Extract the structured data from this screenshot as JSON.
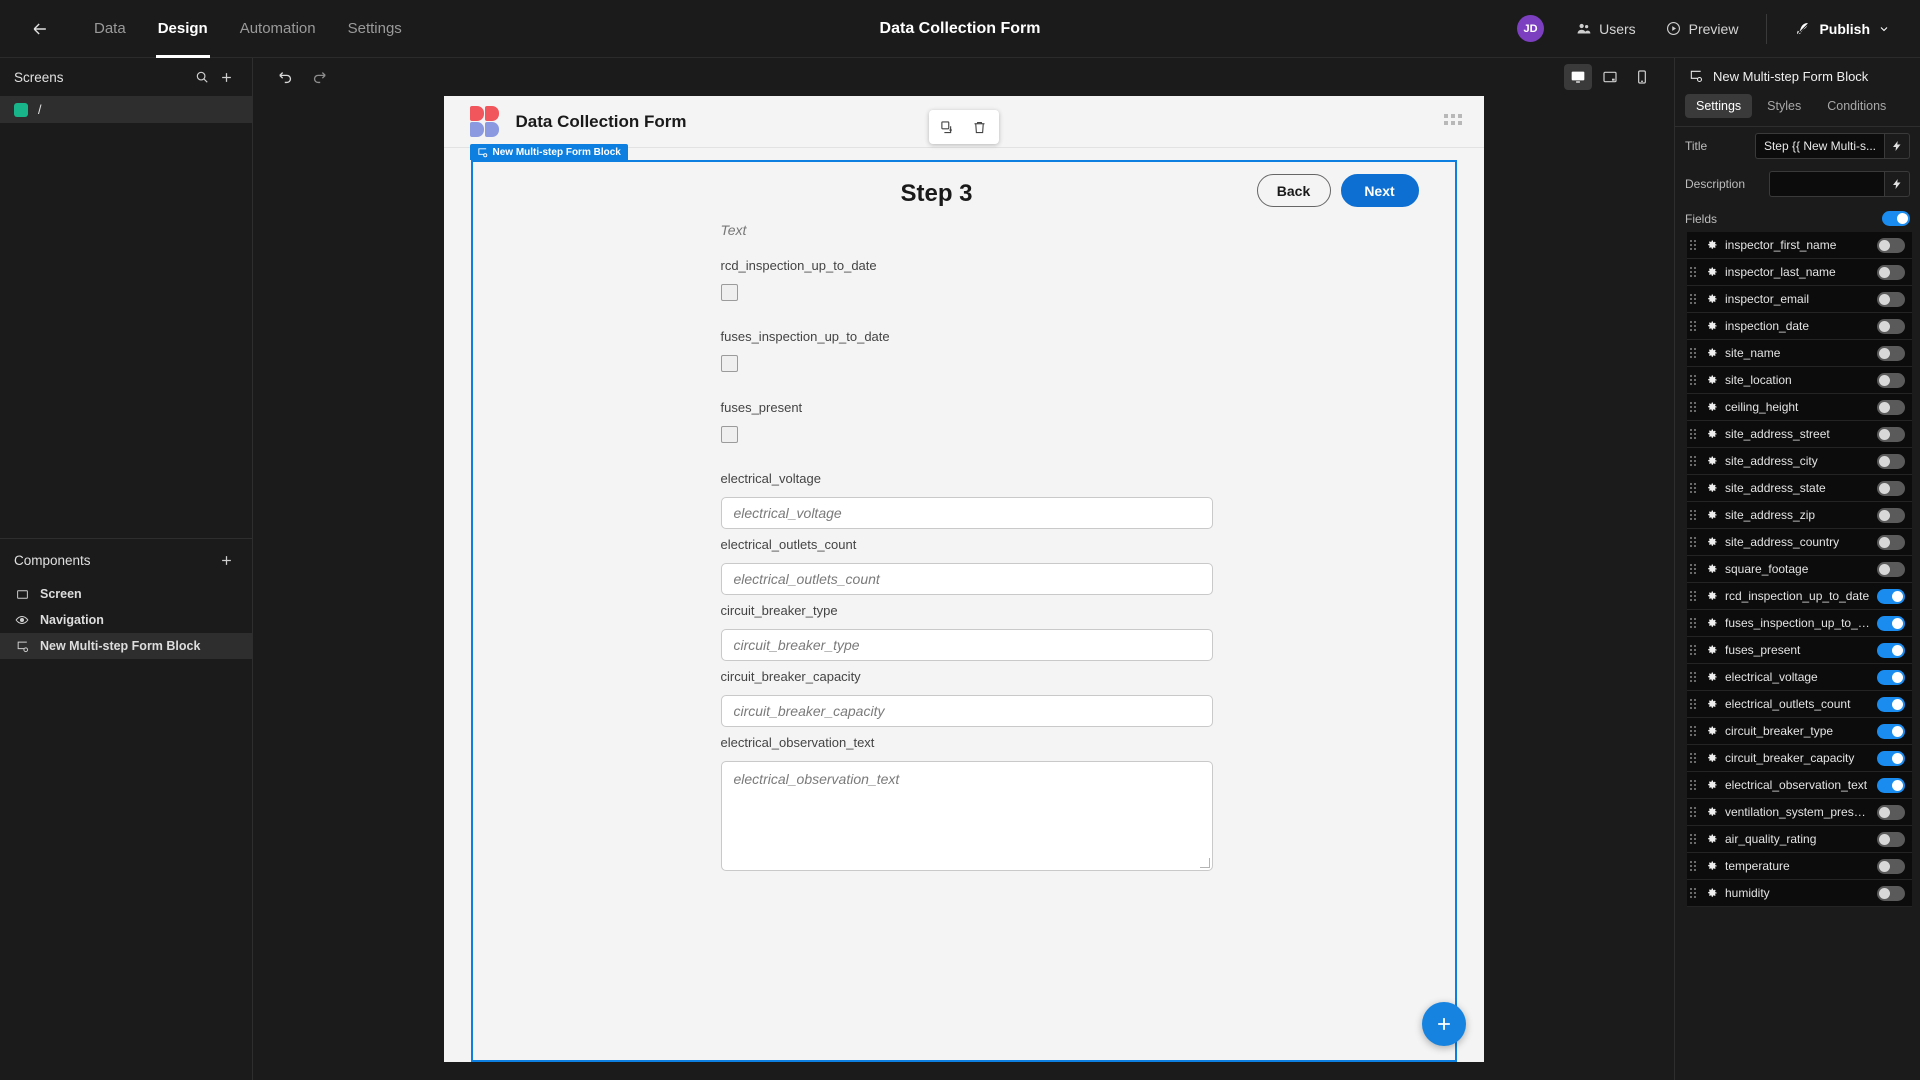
{
  "topbar": {
    "back_icon": "arrow-left-icon",
    "tabs": [
      {
        "label": "Data",
        "active": false
      },
      {
        "label": "Design",
        "active": true
      },
      {
        "label": "Automation",
        "active": false
      },
      {
        "label": "Settings",
        "active": false
      }
    ],
    "title": "Data Collection Form",
    "avatar_initials": "JD",
    "avatar_color": "#7b3fbf",
    "users_label": "Users",
    "preview_label": "Preview",
    "publish_label": "Publish"
  },
  "left_sidebar": {
    "screens_title": "Screens",
    "search_icon": "search-icon",
    "add_icon": "plus-icon",
    "screens": [
      {
        "label": "/",
        "color": "#18b58a",
        "selected": true
      }
    ],
    "components_title": "Components",
    "components_add_icon": "plus-icon",
    "components": [
      {
        "label": "Screen",
        "icon": "screen-icon",
        "selected": false
      },
      {
        "label": "Navigation",
        "icon": "eye-icon",
        "selected": false
      },
      {
        "label": "New Multi-step Form Block",
        "icon": "form-block-icon",
        "selected": true
      }
    ]
  },
  "canvas": {
    "undo_icon": "undo-icon",
    "redo_icon": "redo-icon",
    "devices": [
      {
        "name": "desktop-icon",
        "active": true
      },
      {
        "name": "tablet-icon",
        "active": false
      },
      {
        "name": "mobile-icon",
        "active": false
      }
    ],
    "form_name": "Data Collection Form",
    "header_actions": [
      {
        "name": "duplicate-icon"
      },
      {
        "name": "delete-icon"
      }
    ],
    "grid_icon": "grid-dots-icon",
    "block_badge": "New Multi-step Form Block",
    "step_title": "Step 3",
    "back_button": "Back",
    "next_button": "Next",
    "text_placeholder": "Text",
    "fields": [
      {
        "label": "rcd_inspection_up_to_date",
        "type": "checkbox"
      },
      {
        "label": "fuses_inspection_up_to_date",
        "type": "checkbox"
      },
      {
        "label": "fuses_present",
        "type": "checkbox"
      },
      {
        "label": "electrical_voltage",
        "type": "text",
        "placeholder": "electrical_voltage"
      },
      {
        "label": "electrical_outlets_count",
        "type": "text",
        "placeholder": "electrical_outlets_count"
      },
      {
        "label": "circuit_breaker_type",
        "type": "text",
        "placeholder": "circuit_breaker_type"
      },
      {
        "label": "circuit_breaker_capacity",
        "type": "text",
        "placeholder": "circuit_breaker_capacity"
      },
      {
        "label": "electrical_observation_text",
        "type": "textarea",
        "placeholder": "electrical_observation_text"
      }
    ],
    "fab_icon": "plus-icon",
    "accent_color": "#1683e0"
  },
  "right_panel": {
    "block_icon": "form-block-icon",
    "block_title": "New Multi-step Form Block",
    "tabs": [
      {
        "label": "Settings",
        "active": true
      },
      {
        "label": "Styles",
        "active": false
      },
      {
        "label": "Conditions",
        "active": false
      }
    ],
    "title_label": "Title",
    "title_value": "Step {{ New Multi-s...",
    "description_label": "Description",
    "description_value": "",
    "bolt_icon": "lightning-icon",
    "fields_label": "Fields",
    "fields_enabled": true,
    "fields": [
      {
        "name": "inspector_first_name",
        "enabled": false
      },
      {
        "name": "inspector_last_name",
        "enabled": false
      },
      {
        "name": "inspector_email",
        "enabled": false
      },
      {
        "name": "inspection_date",
        "enabled": false
      },
      {
        "name": "site_name",
        "enabled": false
      },
      {
        "name": "site_location",
        "enabled": false
      },
      {
        "name": "ceiling_height",
        "enabled": false
      },
      {
        "name": "site_address_street",
        "enabled": false
      },
      {
        "name": "site_address_city",
        "enabled": false
      },
      {
        "name": "site_address_state",
        "enabled": false
      },
      {
        "name": "site_address_zip",
        "enabled": false
      },
      {
        "name": "site_address_country",
        "enabled": false
      },
      {
        "name": "square_footage",
        "enabled": false
      },
      {
        "name": "rcd_inspection_up_to_date",
        "enabled": true
      },
      {
        "name": "fuses_inspection_up_to_date",
        "enabled": true
      },
      {
        "name": "fuses_present",
        "enabled": true
      },
      {
        "name": "electrical_voltage",
        "enabled": true
      },
      {
        "name": "electrical_outlets_count",
        "enabled": true
      },
      {
        "name": "circuit_breaker_type",
        "enabled": true
      },
      {
        "name": "circuit_breaker_capacity",
        "enabled": true
      },
      {
        "name": "electrical_observation_text",
        "enabled": true
      },
      {
        "name": "ventilation_system_present",
        "enabled": false
      },
      {
        "name": "air_quality_rating",
        "enabled": false
      },
      {
        "name": "temperature",
        "enabled": false
      },
      {
        "name": "humidity",
        "enabled": false
      }
    ]
  }
}
